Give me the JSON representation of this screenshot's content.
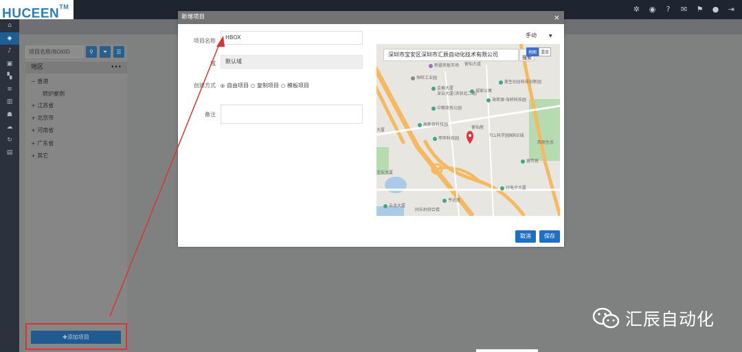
{
  "brand": {
    "logo_text": "HUCEEN",
    "logo_tm": "TM"
  },
  "topbar": {
    "icons": [
      "bug-icon",
      "globe-icon",
      "help-icon",
      "mail-icon",
      "flag-icon",
      "user-icon",
      "exit-icon"
    ]
  },
  "sidebar": {
    "search_placeholder": "项目名称/BOXID",
    "region_label": "地区",
    "region_more": "•••",
    "tree": [
      {
        "label": "香港",
        "prefix": "−",
        "children": [
          "转炉案例"
        ]
      },
      {
        "label": "江苏省",
        "prefix": "+"
      },
      {
        "label": "北京市",
        "prefix": "+"
      },
      {
        "label": "河南省",
        "prefix": "+"
      },
      {
        "label": "广东省",
        "prefix": "+"
      },
      {
        "label": "其它",
        "prefix": "+"
      }
    ],
    "add_button": "✚添加项目"
  },
  "modal": {
    "title": "新增项目",
    "close": "×",
    "fields": {
      "name_label": "项目名称",
      "name_value": "HBOX",
      "domain_label": "域",
      "domain_value": "默认域",
      "create_mode_label": "创建方式",
      "modes": [
        "自由项目",
        "复制项目",
        "模板项目"
      ],
      "selected_mode": "自由项目",
      "note_label": "备注"
    },
    "location_mode": "手动",
    "map": {
      "search_value": "深圳市宝安区深圳市汇辰自动化技术有限公司",
      "search_button": "搜索",
      "map_types": [
        "地图",
        "混合"
      ],
      "selected_type": "地图",
      "pois": [
        "新疆夹板市场",
        "留仙大道",
        "恒旺工业园",
        "金泰大厦",
        "深云大厦(洪浪北二路)",
        "城家公寓",
        "美生创谷科技创新园",
        "海荣源·海桥科技园",
        "中粮商务公园",
        "高新奇科技园",
        "留仙居",
        "甲岸科技园",
        "TCL科学园国际E城",
        "西丽生态",
        "大厦",
        "宝安大厦",
        "留芳居",
        "孖电子大厦",
        "亨达居",
        "同乐村综合楼",
        "云龙大厦"
      ]
    },
    "cancel_label": "取消",
    "save_label": "保存"
  },
  "watermark": {
    "text": "汇辰自动化"
  },
  "colors": {
    "primary": "#1f6fc7",
    "annotation": "#d73535",
    "topbar": "#1f2530"
  }
}
